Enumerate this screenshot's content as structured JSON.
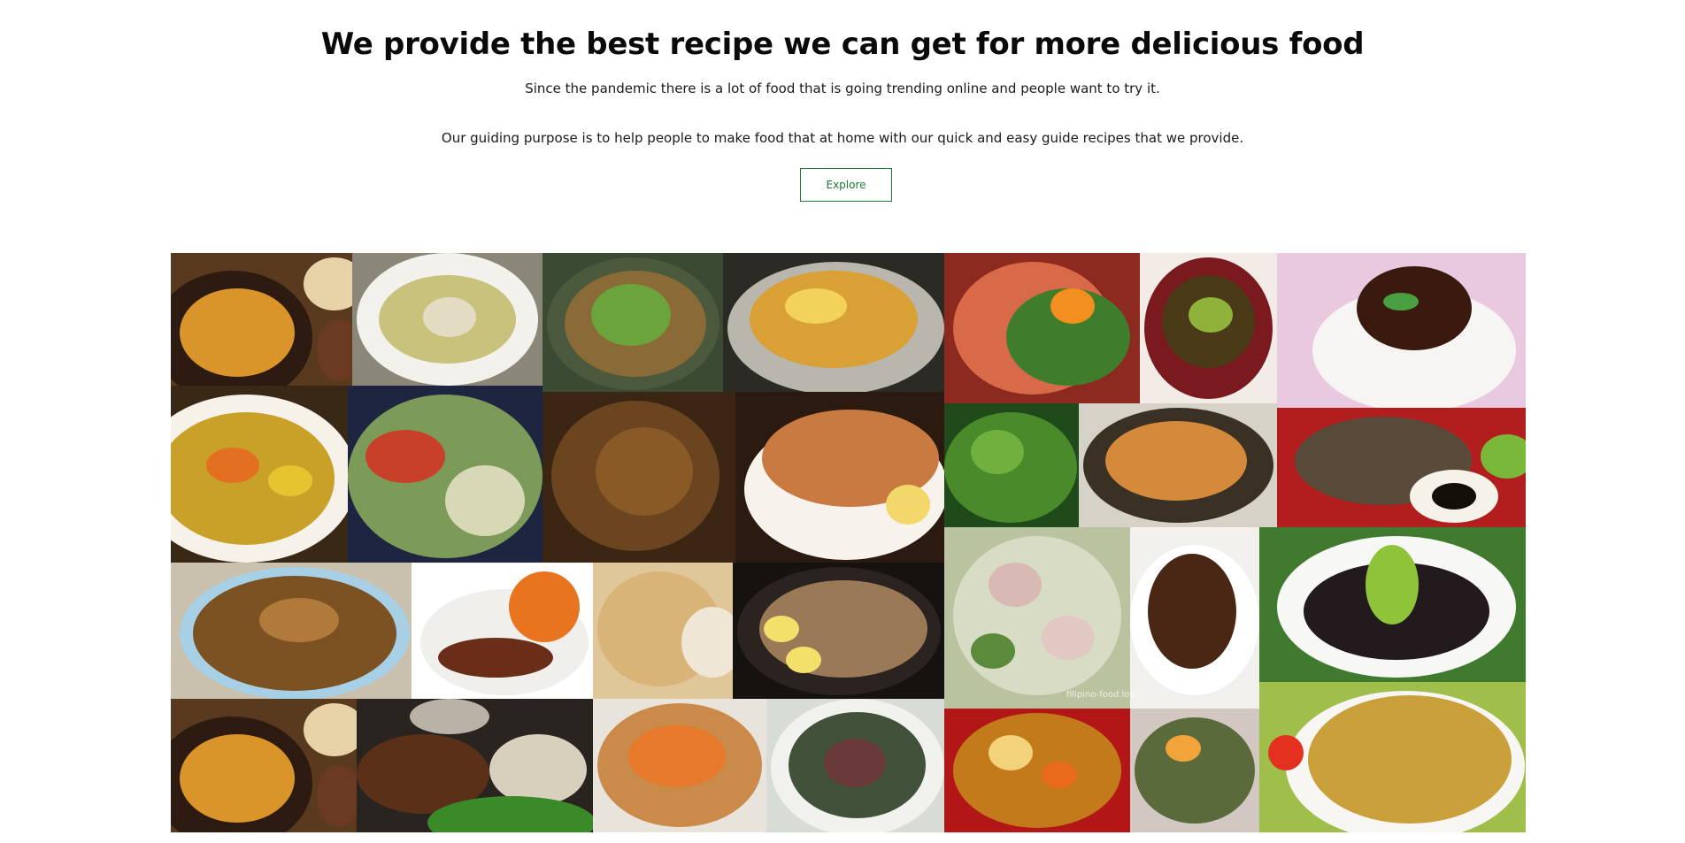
{
  "hero": {
    "title": "We provide the best recipe we can get for more delicious food",
    "line1": "Since the pandemic there is a lot of food that is going trending online and people want to try it.",
    "line2": "Our guiding purpose is to help people to make food that at home with our quick and easy guide recipes that we provide.",
    "explore_label": "Explore"
  },
  "collage": {
    "watermark": "filipino-food.lovi"
  },
  "colors": {
    "accent": "#1f7a32",
    "text": "#111111",
    "background": "#ffffff"
  }
}
